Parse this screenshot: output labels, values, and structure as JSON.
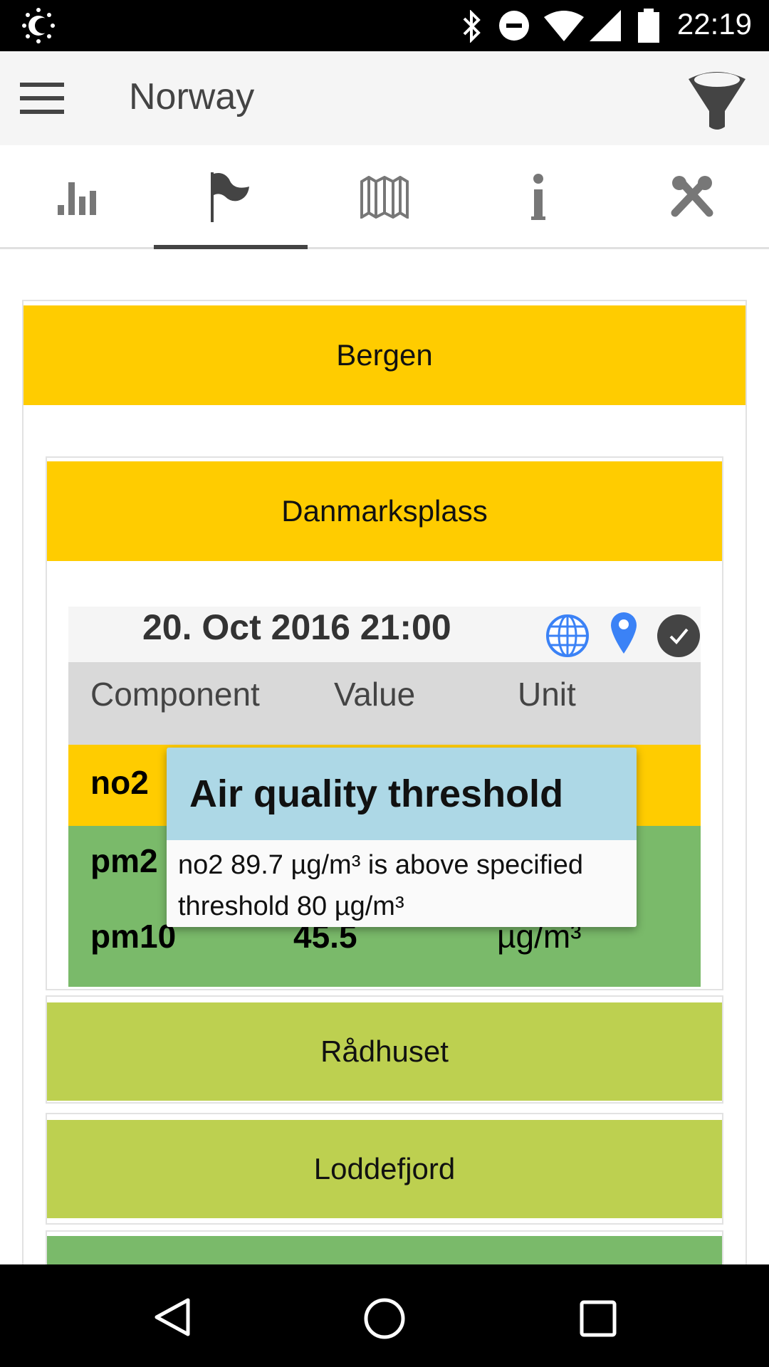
{
  "status_bar": {
    "time": "22:19"
  },
  "app_bar": {
    "title": "Norway"
  },
  "tabs": [
    {
      "icon": "bar-chart-icon"
    },
    {
      "icon": "flag-icon",
      "active": true
    },
    {
      "icon": "map-icon"
    },
    {
      "icon": "info-icon"
    },
    {
      "icon": "tools-icon"
    }
  ],
  "region": {
    "name": "Bergen",
    "color": "#ffcc00"
  },
  "station": {
    "name": "Danmarksplass",
    "color": "#ffcc00",
    "timestamp": "20. Oct 2016 21:00",
    "table": {
      "headers": [
        "Component",
        "Value",
        "Unit"
      ],
      "rows": [
        {
          "component": "no2",
          "color": "#ffcc00"
        },
        {
          "component": "pm2",
          "color": "#7aba6a"
        },
        {
          "component": "pm10",
          "value": "45.5",
          "unit": "µg/m³",
          "color": "#7aba6a"
        }
      ]
    }
  },
  "popup": {
    "title": "Air quality threshold",
    "message": "no2 89.7 µg/m³ is above specified threshold 80 µg/m³"
  },
  "other_stations": [
    {
      "name": "Rådhuset",
      "color": "#bdd050"
    },
    {
      "name": "Loddefjord",
      "color": "#bdd050"
    }
  ]
}
